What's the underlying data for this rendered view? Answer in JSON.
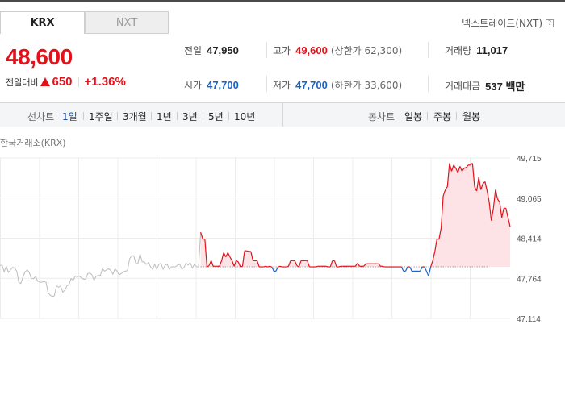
{
  "tabs": [
    {
      "label": "KRX",
      "active": true
    },
    {
      "label": "NXT",
      "active": false
    }
  ],
  "nxt_link": "넥스트레이드(NXT)",
  "help_icon_text": "?",
  "quote": {
    "price": "48,600",
    "change_label": "전일대비",
    "change": "650",
    "change_pct": "+1.36%",
    "direction": "up"
  },
  "stats": {
    "prev_close": {
      "label": "전일",
      "value": "47,950"
    },
    "high": {
      "label": "고가",
      "value": "49,600",
      "sub": "(상한가 62,300)"
    },
    "volume": {
      "label": "거래량",
      "value": "11,017"
    },
    "open": {
      "label": "시가",
      "value": "47,700"
    },
    "low": {
      "label": "저가",
      "value": "47,700",
      "sub": "(하한가 33,600)"
    },
    "amount": {
      "label": "거래대금",
      "value": "537 백만"
    }
  },
  "toolbar": {
    "line_label": "선차트",
    "line_periods": [
      "1일",
      "1주일",
      "3개월",
      "1년",
      "3년",
      "5년",
      "10년"
    ],
    "active_period": "1일",
    "candle_label": "봉차트",
    "candle_periods": [
      "일봉",
      "주봉",
      "월봉"
    ]
  },
  "chart_title": "한국거래소(KRX)",
  "colors": {
    "up": "#e5111a",
    "down": "#1a62c6",
    "area_fill": "#fde3e5",
    "gray_line": "#bdbdbd"
  },
  "chart_data": {
    "type": "line",
    "title": "",
    "xlabel": "",
    "ylabel": "",
    "baseline": 47950,
    "ylim": [
      47114,
      49715
    ],
    "y_ticks": [
      "49,715",
      "49,065",
      "48,414",
      "47,764",
      "47,114"
    ],
    "series": [
      {
        "values": [
          47970,
          47980,
          47870,
          47960,
          47860,
          47900,
          47940,
          47930,
          47880,
          47700,
          47680,
          47790,
          47870,
          47900,
          47860,
          47760,
          47760,
          47790,
          47720,
          47700,
          47700,
          47710,
          47700,
          47530,
          47490,
          47470,
          47480,
          47640,
          47620,
          47640,
          47540,
          47570,
          47640,
          47660,
          47760,
          47730,
          47800,
          47790,
          47800,
          47770,
          47750,
          47750,
          47840,
          47850,
          47820,
          47730,
          47800,
          47810,
          47810,
          47920,
          47880,
          47900,
          47920,
          47890,
          47830,
          47920,
          47880,
          47820,
          47840,
          47870,
          47880,
          47890,
          48080,
          48130,
          48130,
          48000,
          48010,
          48160,
          48030,
          48030,
          47990,
          48020,
          47950,
          47910,
          47990,
          47910,
          47990,
          48010,
          47910,
          47980,
          47990,
          47910,
          47950,
          47950,
          47950,
          47980,
          47990,
          47910,
          47940,
          48010,
          47980,
          48020,
          47930,
          47990,
          47950,
          47950,
          48510,
          48400,
          48400,
          47950,
          47970,
          48050,
          47960,
          47960,
          47960,
          47960,
          48050,
          48180,
          48110,
          48180,
          48110,
          48050,
          47960,
          48050,
          48030,
          47950,
          47960,
          48210,
          48210,
          48200,
          48200,
          48050,
          48050,
          48050,
          47950,
          47950,
          47950,
          47960,
          47950,
          47960,
          47950,
          47880,
          47880,
          47950,
          47960,
          47950,
          47950,
          47950,
          47960,
          48050,
          48050,
          48050,
          47970,
          47950,
          48050,
          48050,
          48050,
          48050,
          47950,
          47950,
          47950,
          47950,
          47960,
          47960,
          47960,
          47960,
          47960,
          47950,
          47950,
          48050,
          48050,
          47950,
          47950,
          47960,
          47960,
          47960,
          47960,
          47960,
          47960,
          47960,
          47960,
          48010,
          47960,
          47960,
          47960,
          48000,
          48000,
          48000,
          48000,
          48000,
          48000,
          48000,
          47960,
          47960,
          47950,
          47950,
          47950,
          47950,
          47950,
          47950,
          47950,
          47950,
          47950,
          47880,
          47880,
          47950,
          47950,
          47880,
          47880,
          47880,
          47880,
          47880,
          47950,
          47950,
          47880,
          47800,
          47950,
          48050,
          48200,
          48400,
          48400,
          48580,
          49100,
          49200,
          49250,
          49630,
          49500,
          49600,
          49550,
          49480,
          49580,
          49500,
          49550,
          49560,
          49600,
          49600,
          49630,
          49250,
          49180,
          49400,
          49200,
          49300,
          49330,
          49180,
          49000,
          48700,
          48900,
          49200,
          49050,
          49000,
          48750,
          48900,
          48900,
          48750,
          48600
        ]
      }
    ]
  }
}
